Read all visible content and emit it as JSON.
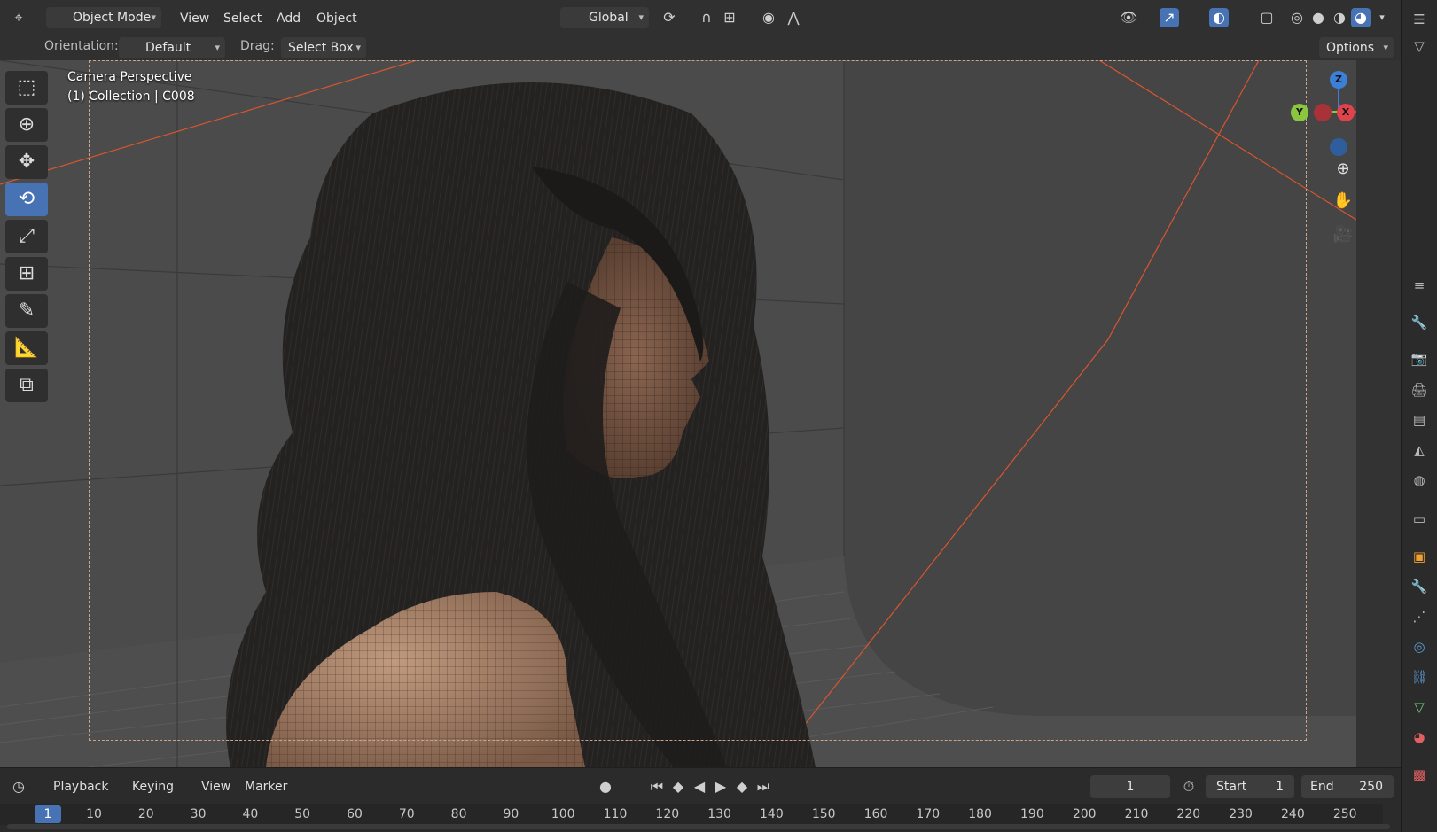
{
  "header": {
    "mode_label": "Object Mode",
    "menu": [
      "View",
      "Select",
      "Add",
      "Object"
    ],
    "transform_orientation": "Global",
    "options_label": "Options"
  },
  "tool_settings": {
    "orientation_label": "Orientation:",
    "orientation_value": "Default",
    "drag_label": "Drag:",
    "drag_value": "Select Box"
  },
  "viewport": {
    "view_name": "Camera Perspective",
    "collection_info": "(1) Collection | C008"
  },
  "gizmo": {
    "z": "Z",
    "y": "Y",
    "x": "X"
  },
  "timeline": {
    "menu": [
      "Playback",
      "Keying",
      "View",
      "Marker"
    ],
    "current_frame": "1",
    "start_label": "Start",
    "start_value": "1",
    "end_label": "End",
    "end_value": "250",
    "ruler_ticks": [
      "1",
      "10",
      "20",
      "30",
      "40",
      "50",
      "60",
      "70",
      "80",
      "90",
      "100",
      "110",
      "120",
      "130",
      "140",
      "150",
      "160",
      "170",
      "180",
      "190",
      "200",
      "210",
      "220",
      "230",
      "240",
      "250"
    ]
  },
  "colors": {
    "accent": "#4772b3",
    "axis_x": "#e0434b",
    "axis_y": "#8bc63f",
    "axis_z": "#3b80d6"
  }
}
